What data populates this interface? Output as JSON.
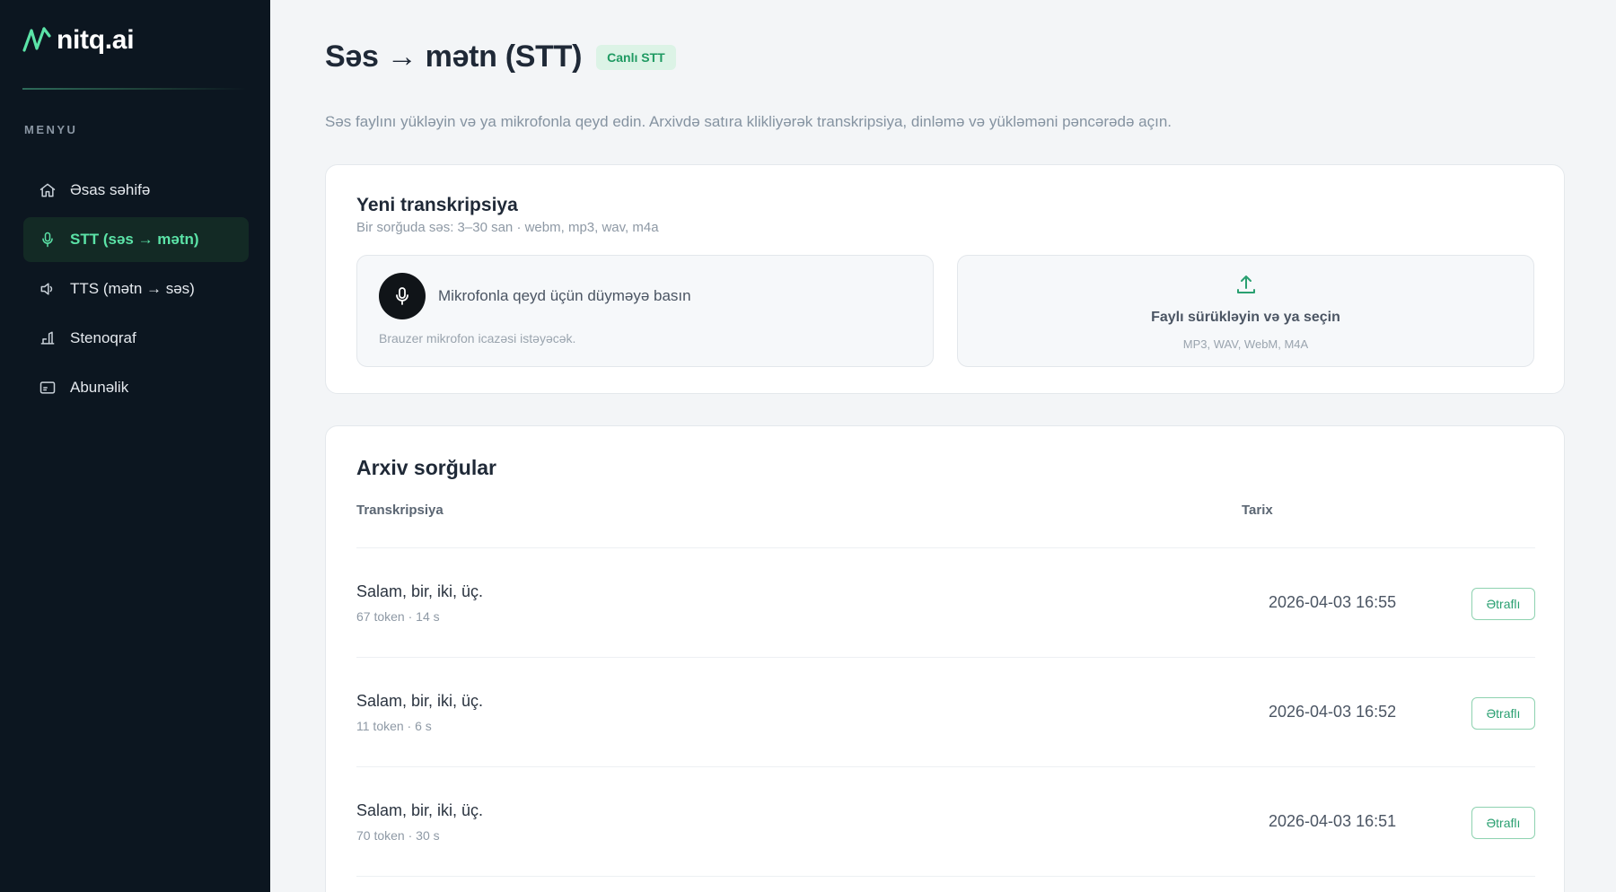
{
  "brand": {
    "name": "nitq.ai",
    "logo_icon": "wave-logo-icon",
    "accent": "#5be3a7"
  },
  "sidebar": {
    "menu_heading": "MENYU",
    "items": [
      {
        "label": "Əsas səhifə",
        "icon": "home-icon",
        "active": false
      },
      {
        "label": "STT (səs → mətn)",
        "icon": "microphone-icon",
        "active": true
      },
      {
        "label": "TTS (mətn → səs)",
        "icon": "speaker-icon",
        "active": false
      },
      {
        "label": "Stenoqraf",
        "icon": "stenograph-icon",
        "active": false
      },
      {
        "label": "Abunəlik",
        "icon": "subscription-card-icon",
        "active": false
      }
    ]
  },
  "page": {
    "title": "Səs → mətn (STT)",
    "badge": "Canlı STT",
    "subtitle": "Səs faylını yükləyin və ya mikrofonla qeyd edin. Arxivdə satıra klikliyərək transkripsiya, dinləmə və yükləməni pəncərədə açın."
  },
  "new_transcription": {
    "title": "Yeni transkripsiya",
    "hint": "Bir sorğuda səs: 3–30 san · webm, mp3, wav, m4a",
    "mic": {
      "label": "Mikrofonla qeyd üçün düyməyə basın",
      "note": "Brauzer mikrofon icazəsi istəyəcək.",
      "icon": "microphone-icon"
    },
    "upload": {
      "label": "Faylı sürükləyin və ya seçin",
      "formats": "MP3, WAV, WebM, M4A",
      "icon": "upload-icon"
    }
  },
  "archive": {
    "title": "Arxiv sorğular",
    "columns": {
      "transcription": "Transkripsiya",
      "date": "Tarix"
    },
    "rows": [
      {
        "text": "Salam, bir, iki, üç.",
        "meta": "67 token · 14 s",
        "date": "2026-04-03 16:55",
        "action": "Ətraflı"
      },
      {
        "text": "Salam, bir, iki, üç.",
        "meta": "11 token · 6 s",
        "date": "2026-04-03 16:52",
        "action": "Ətraflı"
      },
      {
        "text": "Salam, bir, iki, üç.",
        "meta": "70 token · 30 s",
        "date": "2026-04-03 16:51",
        "action": "Ətraflı"
      }
    ]
  }
}
